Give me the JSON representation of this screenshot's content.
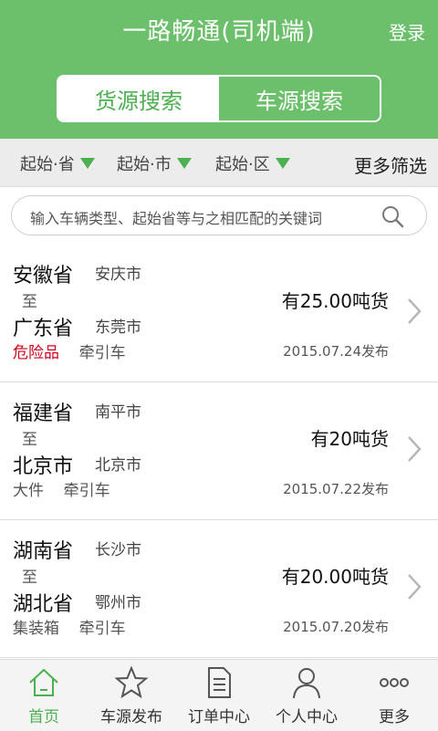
{
  "header": {
    "title": "一路畅通(司机端)",
    "login": "登录"
  },
  "segment": {
    "active": "货源搜索",
    "inactive": "车源搜索"
  },
  "filters": {
    "province": "起始·省",
    "city": "起始·市",
    "district": "起始·区",
    "more": "更多筛选"
  },
  "search": {
    "placeholder": "输入车辆类型、起始省等与之相匹配的关键词"
  },
  "listings": [
    {
      "from_province": "安徽省",
      "from_city": "安庆市",
      "to_label": "至",
      "to_province": "广东省",
      "to_city": "东莞市",
      "tag1": "危险品",
      "tag2": "牵引车",
      "weight": "有25.00吨货",
      "date": "2015.07.24发布"
    },
    {
      "from_province": "福建省",
      "from_city": "南平市",
      "to_label": "至",
      "to_province": "北京市",
      "to_city": "北京市",
      "tag1": "大件",
      "tag2": "牵引车",
      "weight": "有20吨货",
      "date": "2015.07.22发布"
    },
    {
      "from_province": "湖南省",
      "from_city": "长沙市",
      "to_label": "至",
      "to_province": "湖北省",
      "to_city": "鄂州市",
      "tag1": "集装箱",
      "tag2": "牵引车",
      "weight": "有20.00吨货",
      "date": "2015.07.20发布"
    }
  ],
  "tabs": {
    "home": "首页",
    "publish": "车源发布",
    "orders": "订单中心",
    "profile": "个人中心",
    "more": "更多"
  },
  "colors": {
    "brand": "#6cbf6b",
    "active": "#4caf50",
    "danger": "#d0021b"
  }
}
